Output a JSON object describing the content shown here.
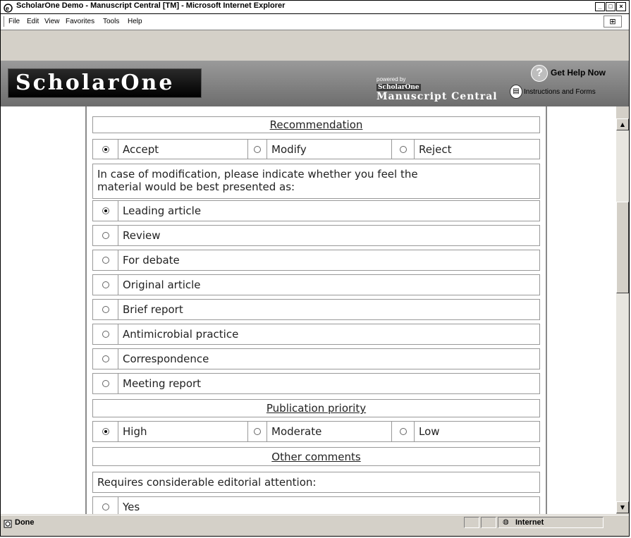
{
  "window": {
    "title": "ScholarOne Demo - Manuscript Central [TM] - Microsoft Internet Explorer"
  },
  "menu": [
    "File",
    "Edit",
    "View",
    "Favorites",
    "Tools",
    "Help"
  ],
  "banner": {
    "logo": "ScholarOne",
    "powered_by": "powered by",
    "powered_brand": "ScholarOne",
    "product": "Manuscript Central",
    "help": "Get Help Now",
    "instructions": "Instructions and Forms"
  },
  "form": {
    "recommendation": {
      "heading": "Recommendation",
      "options": [
        "Accept",
        "Modify",
        "Reject"
      ],
      "selected": "Accept"
    },
    "modification": {
      "prompt_line1": "In case of modification, please indicate whether you feel the",
      "prompt_line2": "material would be best presented as:",
      "options": [
        "Leading article",
        "Review",
        "For debate",
        "Original article",
        "Brief report",
        "Antimicrobial practice",
        "Correspondence",
        "Meeting report"
      ],
      "selected": "Leading article"
    },
    "priority": {
      "heading": "Publication priority",
      "options": [
        "High",
        "Moderate",
        "Low"
      ],
      "selected": "High"
    },
    "other": {
      "heading": "Other comments",
      "prompt": "Requires considerable editorial attention:",
      "options": [
        "Yes"
      ]
    }
  },
  "status": {
    "text": "Done",
    "zone": "Internet"
  }
}
